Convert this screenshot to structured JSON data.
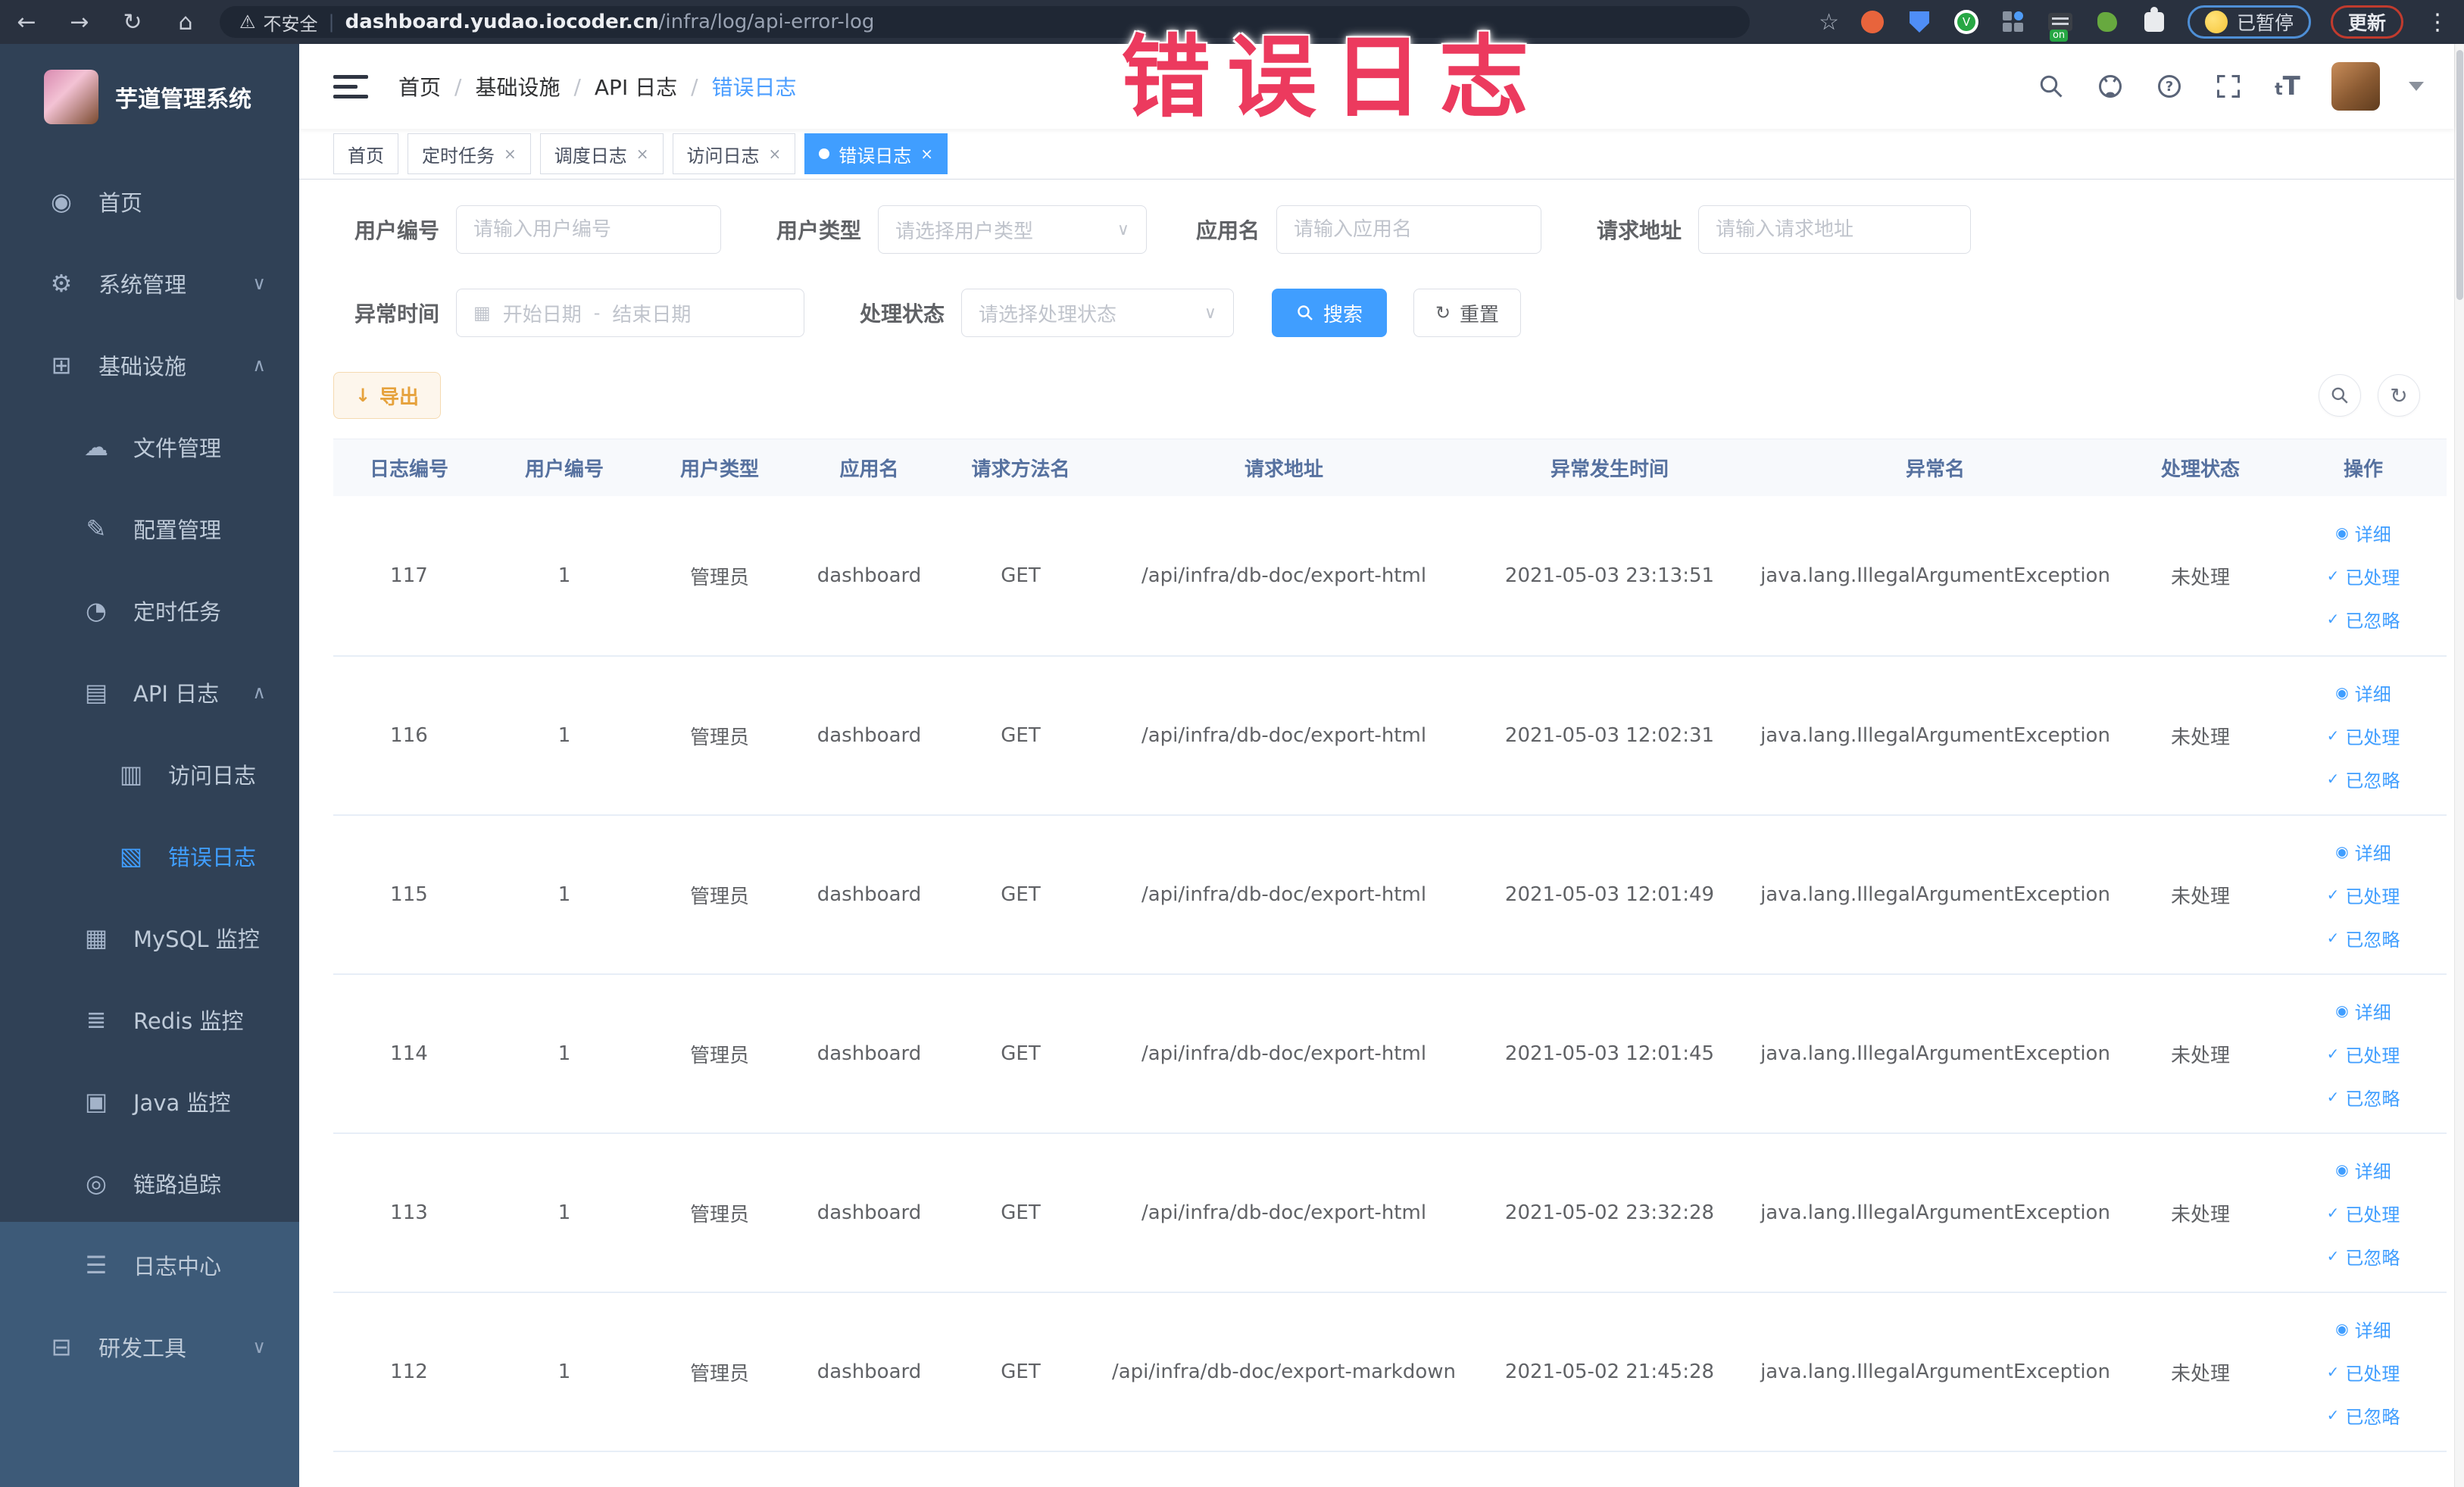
{
  "overlay_title": "错误日志",
  "browser": {
    "security_label": "不安全",
    "url_host": "dashboard.yudao.iocoder.cn",
    "url_path": "/infra/log/api-error-log",
    "nav_icons": [
      "back-icon",
      "forward-icon",
      "reload-icon",
      "home-icon"
    ],
    "extension_icons": [
      "bookmark-star-icon",
      "ext-orange-circle-icon",
      "ext-blue-shield-icon",
      "ext-green-check-icon",
      "ext-grid-icon",
      "ext-dark-on-icon",
      "ext-plant-icon",
      "extensions-puzzle-icon"
    ],
    "paused_badge": "已暂停",
    "update_button": "更新"
  },
  "sidebar": {
    "title": "芋道管理系统",
    "items": [
      {
        "label": "首页",
        "icon": "dashboard-icon",
        "level": 1
      },
      {
        "label": "系统管理",
        "icon": "gear-icon",
        "level": 1,
        "chevron": "down"
      },
      {
        "label": "基础设施",
        "icon": "infrastructure-icon",
        "level": 1,
        "chevron": "up"
      },
      {
        "label": "文件管理",
        "icon": "file-manage-icon",
        "level": 2
      },
      {
        "label": "配置管理",
        "icon": "config-manage-icon",
        "level": 2
      },
      {
        "label": "定时任务",
        "icon": "scheduled-job-icon",
        "level": 2
      },
      {
        "label": "API 日志",
        "icon": "api-log-icon",
        "level": 2,
        "chevron": "up"
      },
      {
        "label": "访问日志",
        "icon": "access-log-icon",
        "level": 3
      },
      {
        "label": "错误日志",
        "icon": "error-log-icon",
        "level": 3,
        "active": true
      },
      {
        "label": "MySQL 监控",
        "icon": "mysql-monitor-icon",
        "level": 2
      },
      {
        "label": "Redis 监控",
        "icon": "redis-monitor-icon",
        "level": 2
      },
      {
        "label": "Java 监控",
        "icon": "java-monitor-icon",
        "level": 2
      },
      {
        "label": "链路追踪",
        "icon": "trace-icon",
        "level": 2
      },
      {
        "label": "日志中心",
        "icon": "log-center-icon",
        "level": 2
      },
      {
        "label": "研发工具",
        "icon": "dev-tools-icon",
        "level": 1,
        "chevron": "down",
        "highlighted": true
      }
    ]
  },
  "header": {
    "breadcrumb": [
      "首页",
      "基础设施",
      "API 日志",
      "错误日志"
    ],
    "action_icons": [
      "search-icon",
      "github-icon",
      "help-icon",
      "fullscreen-icon",
      "font-size-icon"
    ]
  },
  "tabs": [
    {
      "label": "首页",
      "closable": false,
      "active": false
    },
    {
      "label": "定时任务",
      "closable": true,
      "active": false
    },
    {
      "label": "调度日志",
      "closable": true,
      "active": false
    },
    {
      "label": "访问日志",
      "closable": true,
      "active": false
    },
    {
      "label": "错误日志",
      "closable": true,
      "active": true
    }
  ],
  "filters": {
    "user_id": {
      "label": "用户编号",
      "placeholder": "请输入用户编号"
    },
    "user_type": {
      "label": "用户类型",
      "placeholder": "请选择用户类型"
    },
    "app_name": {
      "label": "应用名",
      "placeholder": "请输入应用名"
    },
    "request_url": {
      "label": "请求地址",
      "placeholder": "请输入请求地址"
    },
    "exception_time": {
      "label": "异常时间",
      "start_placeholder": "开始日期",
      "separator": "-",
      "end_placeholder": "结束日期"
    },
    "process_status": {
      "label": "处理状态",
      "placeholder": "请选择处理状态"
    },
    "search_label": "搜索",
    "reset_label": "重置",
    "export_label": "导出"
  },
  "table": {
    "columns": [
      "日志编号",
      "用户编号",
      "用户类型",
      "应用名",
      "请求方法名",
      "请求地址",
      "异常发生时间",
      "异常名",
      "处理状态",
      "操作"
    ],
    "action_labels": [
      "详细",
      "已处理",
      "已忽略"
    ],
    "rows": [
      {
        "id": "117",
        "user_id": "1",
        "user_type": "管理员",
        "app": "dashboard",
        "method": "GET",
        "url": "/api/infra/db-doc/export-html",
        "time": "2021-05-03 23:13:51",
        "exception": "java.lang.IllegalArgumentException",
        "status": "未处理"
      },
      {
        "id": "116",
        "user_id": "1",
        "user_type": "管理员",
        "app": "dashboard",
        "method": "GET",
        "url": "/api/infra/db-doc/export-html",
        "time": "2021-05-03 12:02:31",
        "exception": "java.lang.IllegalArgumentException",
        "status": "未处理"
      },
      {
        "id": "115",
        "user_id": "1",
        "user_type": "管理员",
        "app": "dashboard",
        "method": "GET",
        "url": "/api/infra/db-doc/export-html",
        "time": "2021-05-03 12:01:49",
        "exception": "java.lang.IllegalArgumentException",
        "status": "未处理"
      },
      {
        "id": "114",
        "user_id": "1",
        "user_type": "管理员",
        "app": "dashboard",
        "method": "GET",
        "url": "/api/infra/db-doc/export-html",
        "time": "2021-05-03 12:01:45",
        "exception": "java.lang.IllegalArgumentException",
        "status": "未处理"
      },
      {
        "id": "113",
        "user_id": "1",
        "user_type": "管理员",
        "app": "dashboard",
        "method": "GET",
        "url": "/api/infra/db-doc/export-html",
        "time": "2021-05-02 23:32:28",
        "exception": "java.lang.IllegalArgumentException",
        "status": "未处理"
      },
      {
        "id": "112",
        "user_id": "1",
        "user_type": "管理员",
        "app": "dashboard",
        "method": "GET",
        "url": "/api/infra/db-doc/export-markdown",
        "time": "2021-05-02 21:45:28",
        "exception": "java.lang.IllegalArgumentException",
        "status": "未处理"
      }
    ]
  },
  "colors": {
    "accent": "#409eff",
    "warning": "#e6a23c",
    "overlay_pink": "#ec3a5e",
    "sidebar_bg": "#304156",
    "chrome_bg": "#29313f"
  }
}
